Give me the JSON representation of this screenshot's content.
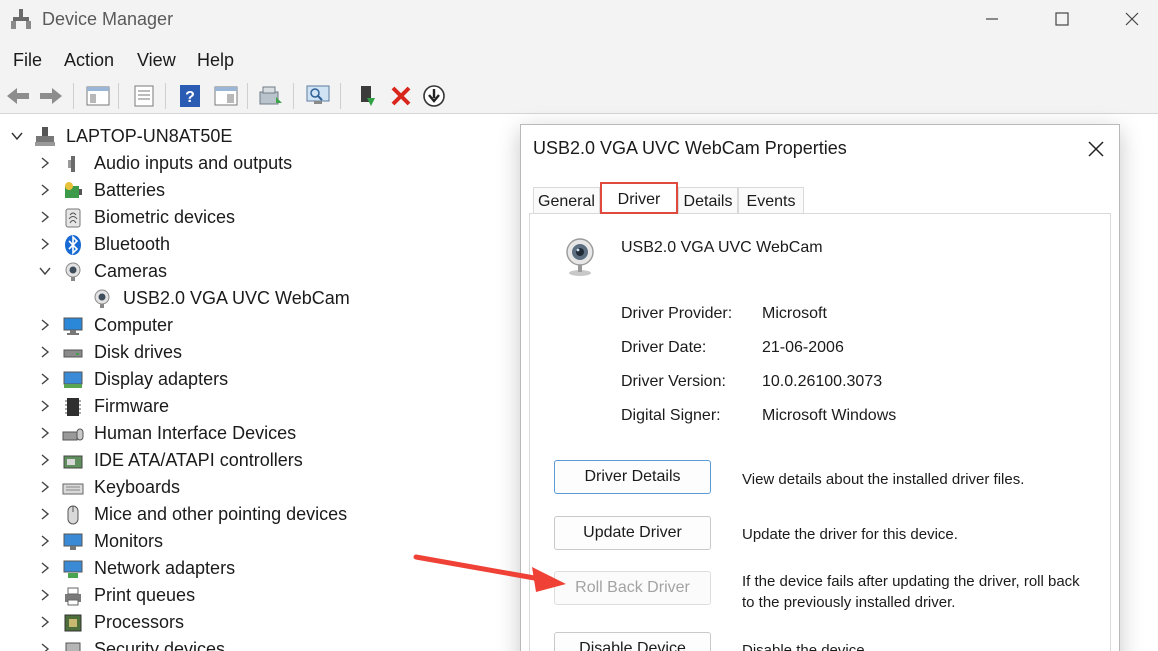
{
  "window": {
    "title": "Device Manager",
    "minimize_icon": "minimize-icon",
    "maximize_icon": "maximize-icon",
    "close_icon": "close-icon"
  },
  "menu": [
    "File",
    "Action",
    "View",
    "Help"
  ],
  "toolbar": [
    "back-arrow-icon",
    "forward-arrow-icon",
    "properties-pane-icon",
    "device-properties-icon",
    "help-icon",
    "show-hide-console-icon",
    "update-driver-icon",
    "scan-hardware-icon",
    "enable-device-icon",
    "uninstall-device-icon",
    "disable-device-icon"
  ],
  "tree": {
    "root": "LAPTOP-UN8AT50E",
    "items": [
      {
        "label": "Audio inputs and outputs",
        "icon": "speaker-icon",
        "expanded": false
      },
      {
        "label": "Batteries",
        "icon": "battery-icon",
        "expanded": false
      },
      {
        "label": "Biometric devices",
        "icon": "fingerprint-icon",
        "expanded": false
      },
      {
        "label": "Bluetooth",
        "icon": "bluetooth-icon",
        "expanded": false
      },
      {
        "label": "Cameras",
        "icon": "camera-icon",
        "expanded": true
      },
      {
        "label": "USB2.0 VGA UVC WebCam",
        "icon": "webcam-icon",
        "child": true
      },
      {
        "label": "Computer",
        "icon": "computer-icon",
        "expanded": false
      },
      {
        "label": "Disk drives",
        "icon": "disk-drive-icon",
        "expanded": false
      },
      {
        "label": "Display adapters",
        "icon": "display-adapter-icon",
        "expanded": false
      },
      {
        "label": "Firmware",
        "icon": "firmware-icon",
        "expanded": false
      },
      {
        "label": "Human Interface Devices",
        "icon": "hid-icon",
        "expanded": false
      },
      {
        "label": "IDE ATA/ATAPI controllers",
        "icon": "ide-controller-icon",
        "expanded": false
      },
      {
        "label": "Keyboards",
        "icon": "keyboard-icon",
        "expanded": false
      },
      {
        "label": "Mice and other pointing devices",
        "icon": "mouse-icon",
        "expanded": false
      },
      {
        "label": "Monitors",
        "icon": "monitor-icon",
        "expanded": false
      },
      {
        "label": "Network adapters",
        "icon": "network-adapter-icon",
        "expanded": false
      },
      {
        "label": "Print queues",
        "icon": "printer-icon",
        "expanded": false
      },
      {
        "label": "Processors",
        "icon": "processor-icon",
        "expanded": false
      },
      {
        "label": "Security devices",
        "icon": "security-device-icon",
        "expanded": false
      }
    ]
  },
  "dialog": {
    "title": "USB2.0 VGA UVC WebCam Properties",
    "tabs": [
      "General",
      "Driver",
      "Details",
      "Events"
    ],
    "active_tab": "Driver",
    "device_name": "USB2.0 VGA UVC WebCam",
    "properties": [
      {
        "label": "Driver Provider:",
        "value": "Microsoft"
      },
      {
        "label": "Driver Date:",
        "value": "21-06-2006"
      },
      {
        "label": "Driver Version:",
        "value": "10.0.26100.3073"
      },
      {
        "label": "Digital Signer:",
        "value": "Microsoft Windows"
      }
    ],
    "buttons": [
      {
        "label": "Driver Details",
        "desc": "View details about the installed driver files.",
        "enabled": true
      },
      {
        "label": "Update Driver",
        "desc": "Update the driver for this device.",
        "enabled": true
      },
      {
        "label": "Roll Back Driver",
        "desc": "If the device fails after updating the driver, roll back to the previously installed driver.",
        "enabled": false
      },
      {
        "label": "Disable Device",
        "desc": "Disable the device.",
        "enabled": true
      }
    ]
  },
  "colors": {
    "highlight": "#e04a3d",
    "annotation_arrow": "#ef4136",
    "primary_button_border": "#5b9ad5"
  }
}
